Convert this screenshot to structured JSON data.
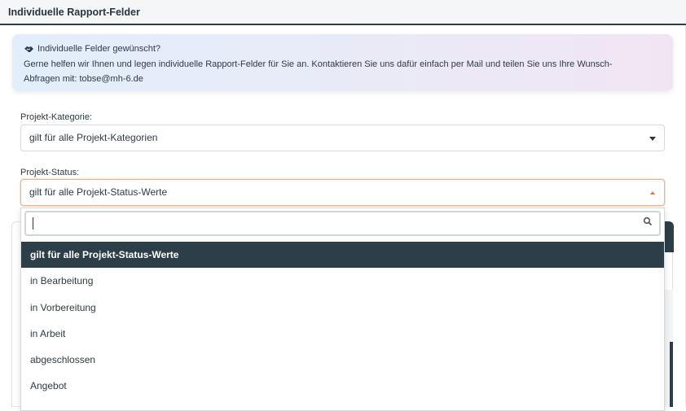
{
  "panel": {
    "title": "Individuelle Rapport-Felder"
  },
  "info": {
    "icon": "handshake-icon",
    "title": "Individuelle Felder gewünscht?",
    "text_line1": "Gerne helfen wir Ihnen und legen individuelle Rapport-Felder für Sie an. Kontaktieren Sie uns dafür einfach per Mail und teilen Sie uns Ihre Wunsch-",
    "text_line2": "Abfragen mit: tobse@mh-6.de"
  },
  "form": {
    "kategorie_label": "Projekt-Kategorie:",
    "kategorie_value": "gilt für alle Projekt-Kategorien",
    "status_label": "Projekt-Status:",
    "status_value": "gilt für alle Projekt-Status-Werte"
  },
  "dropdown": {
    "search_value": "",
    "options": [
      "gilt für alle Projekt-Status-Werte",
      "in Bearbeitung",
      "in Vorbereitung",
      "in Arbeit",
      "abgeschlossen",
      "Angebot"
    ],
    "selected_index": 0
  },
  "colors": {
    "header_border": "#2c3e48",
    "selected_bg": "#2c3e48",
    "focus_border": "#f0b48a",
    "arrow_up": "#e07a3b"
  }
}
